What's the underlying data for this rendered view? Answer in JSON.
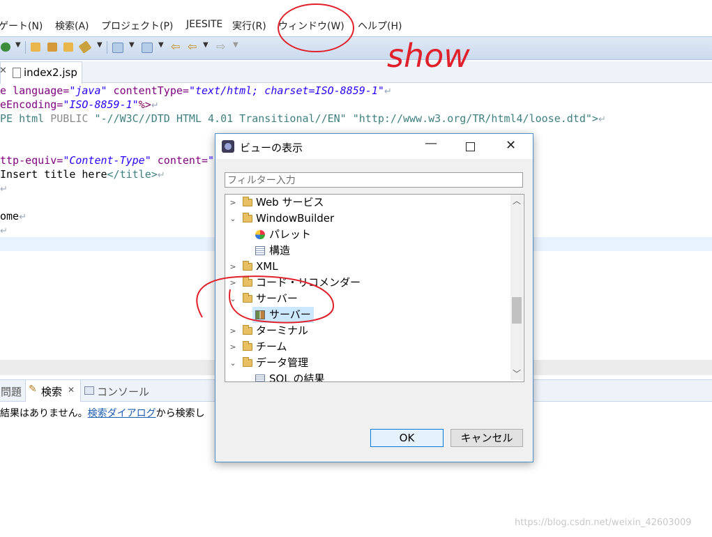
{
  "menu": [
    "ゲート(N)",
    "検索(A)",
    "プロジェクト(P)",
    "JEESITE",
    "実行(R)",
    "ウィンドウ(W)",
    "ヘルプ(H)"
  ],
  "editor": {
    "tab_label": "index2.jsp",
    "lines": {
      "l1": [
        "e language=",
        "\"java\"",
        " contentType=",
        "\"text/html; charset=ISO-8859-1\""
      ],
      "l2": [
        "eEncoding=",
        "\"ISO-8859-1\"",
        "%>"
      ],
      "l3": [
        "PE html ",
        "PUBLIC ",
        "\"-//W3C//DTD HTML 4.01 Transitional//EN\" \"http://www.w3.org/TR/html4/loose.dtd\"",
        ">"
      ],
      "l5": [
        "ttp-equiv=",
        "\"Content-Type\"",
        " content=",
        "\"t"
      ],
      "l6": [
        "Insert title here",
        "</title>"
      ],
      "l9": "ome"
    }
  },
  "bottom_panel": {
    "tabs": [
      "問題",
      "検索",
      "コンソール"
    ],
    "message_prefix": "結果はありません。",
    "message_link": "検索ダイアログ",
    "message_suffix": "から検索し"
  },
  "dialog": {
    "title": "ビューの表示",
    "filter_placeholder": "フィルター入力",
    "tree": [
      {
        "label": "Web サービス",
        "expanded": false,
        "type": "folder"
      },
      {
        "label": "WindowBuilder",
        "expanded": true,
        "type": "folder"
      },
      {
        "label": "パレット",
        "type": "leaf",
        "icon": "palette-icon"
      },
      {
        "label": "構造",
        "type": "leaf",
        "icon": "structure-icon"
      },
      {
        "label": "XML",
        "expanded": false,
        "type": "folder"
      },
      {
        "label": "コード・リコメンダー",
        "expanded": false,
        "type": "folder"
      },
      {
        "label": "サーバー",
        "expanded": true,
        "type": "folder"
      },
      {
        "label": "サーバー",
        "type": "leaf",
        "icon": "server-icon",
        "selected": true
      },
      {
        "label": "ターミナル",
        "expanded": false,
        "type": "folder"
      },
      {
        "label": "チーム",
        "expanded": false,
        "type": "folder"
      },
      {
        "label": "データ管理",
        "expanded": true,
        "type": "folder"
      },
      {
        "label": "SQL の結果",
        "type": "leaf",
        "icon": "table-icon"
      }
    ],
    "ok_label": "OK",
    "cancel_label": "キャンセル"
  },
  "annotation_text": "show",
  "watermark": "https://blog.csdn.net/weixin_42603009",
  "colors": {
    "annotation": "#e0202a",
    "selection": "#cce8ff",
    "accent": "#0078d7"
  }
}
